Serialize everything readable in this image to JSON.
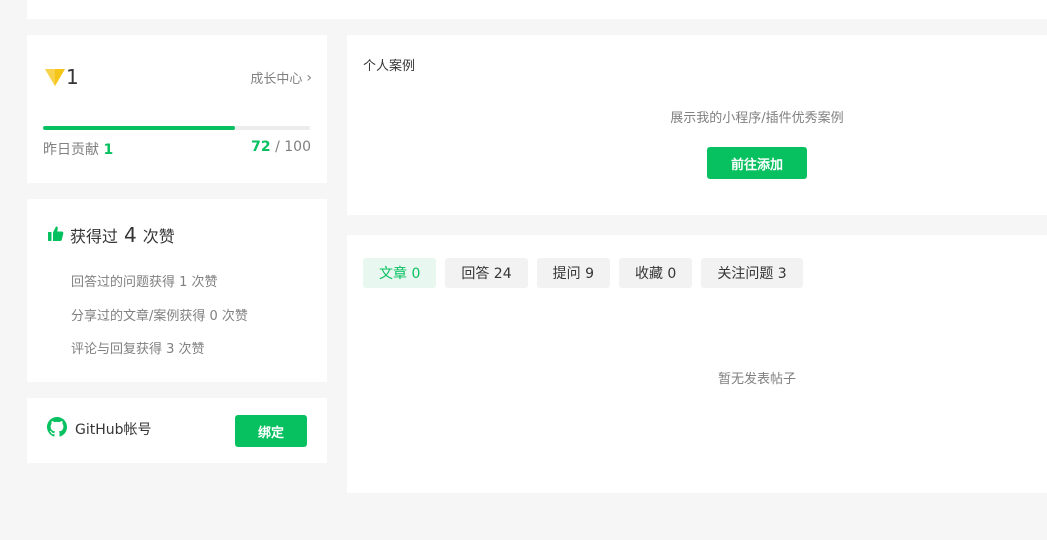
{
  "level": {
    "value": "1",
    "growth_center": "成长中心",
    "yesterday_label": "昨日贡献",
    "yesterday_value": "1",
    "score": "72",
    "score_max": "/ 100",
    "progress": 0.72
  },
  "likes": {
    "prefix": "获得过",
    "count": "4",
    "suffix": "次赞",
    "items": [
      "回答过的问题获得 1 次赞",
      "分享过的文章/案例获得 0 次赞",
      "评论与回复获得 3 次赞"
    ]
  },
  "github": {
    "label": "GitHub帐号",
    "bind_label": "绑定"
  },
  "case": {
    "title": "个人案例",
    "empty_text": "展示我的小程序/插件优秀案例",
    "add_label": "前往添加"
  },
  "posts": {
    "tabs": [
      {
        "label": "文章 0",
        "active": true
      },
      {
        "label": "回答 24",
        "active": false
      },
      {
        "label": "提问 9",
        "active": false
      },
      {
        "label": "收藏 0",
        "active": false
      },
      {
        "label": "关注问题 3",
        "active": false
      }
    ],
    "empty_text": "暂无发表帖子"
  },
  "colors": {
    "accent": "#07c160",
    "badge": "#f5c518",
    "background": "#f6f6f6"
  },
  "icons": {
    "level_badge": "level-badge-icon",
    "thumbs_up": "thumbs-up-icon",
    "github": "github-icon",
    "chevron": "chevron-right-icon"
  }
}
